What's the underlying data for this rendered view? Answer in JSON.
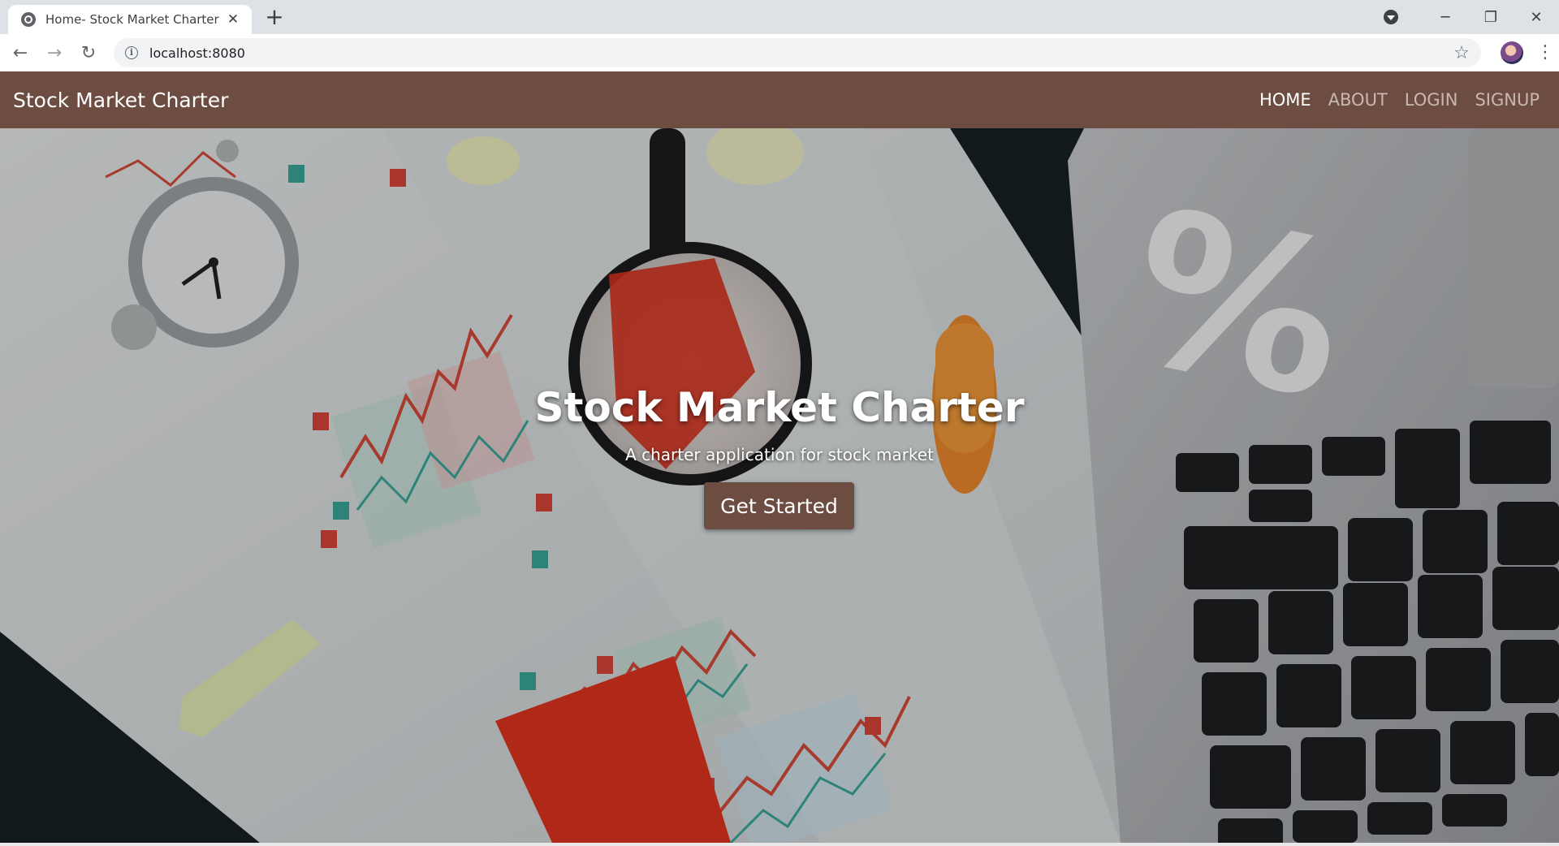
{
  "browser": {
    "tab_title": "Home- Stock Market Charter",
    "tab_close": "✕",
    "new_tab": "+",
    "url": "localhost:8080",
    "win_minimize": "─",
    "win_restore": "❐",
    "win_close": "✕",
    "back": "←",
    "forward": "→",
    "reload": "↻",
    "star": "☆",
    "menu": "⋮",
    "info": "i"
  },
  "navbar": {
    "brand": "Stock Market Charter",
    "links": [
      {
        "label": "HOME",
        "active": true
      },
      {
        "label": "ABOUT",
        "active": false
      },
      {
        "label": "LOGIN",
        "active": false
      },
      {
        "label": "SIGNUP",
        "active": false
      }
    ]
  },
  "hero": {
    "title": "Stock Market Charter",
    "subtitle": "A charter application for stock market",
    "cta": "Get Started"
  },
  "colors": {
    "navbar_bg": "#6d4c41",
    "button_bg": "#6d4c41",
    "nav_active": "#ffffff",
    "nav_inactive": "#c9b7b1"
  }
}
